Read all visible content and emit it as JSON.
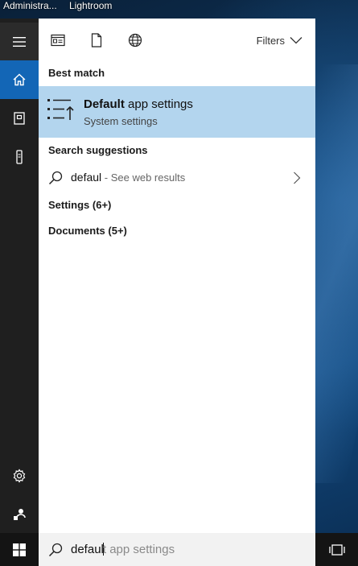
{
  "desktop": {
    "labels": [
      "Administra...",
      "Lightroom"
    ]
  },
  "colors": {
    "rail_bg": "#1f1f1f",
    "accent": "#1366b6",
    "best_match_bg": "#b3d5ee",
    "panel_bg": "#ffffff",
    "taskbar_bg": "#141414"
  },
  "rail": {
    "items": [
      {
        "icon": "hamburger-menu-icon"
      },
      {
        "icon": "home-icon",
        "selected": true
      },
      {
        "icon": "notebook-icon"
      },
      {
        "icon": "device-icon"
      },
      {
        "icon": "gear-icon"
      },
      {
        "icon": "feedback-icon"
      }
    ]
  },
  "topbar": {
    "icons": [
      "apps-filter-icon",
      "documents-filter-icon",
      "web-filter-icon"
    ],
    "filters_label": "Filters"
  },
  "results": {
    "best_match_header": "Best match",
    "best_match": {
      "title_bold": "Default",
      "title_rest": " app settings",
      "subtitle": "System settings",
      "icon": "default-apps-icon"
    },
    "suggestions_header": "Search suggestions",
    "suggestion": {
      "query": "defaul",
      "web_hint": " - See web results"
    },
    "settings_header": "Settings (6+)",
    "documents_header": "Documents (5+)"
  },
  "taskbar": {
    "search_typed": "defaul",
    "search_completion": "t app settings"
  }
}
